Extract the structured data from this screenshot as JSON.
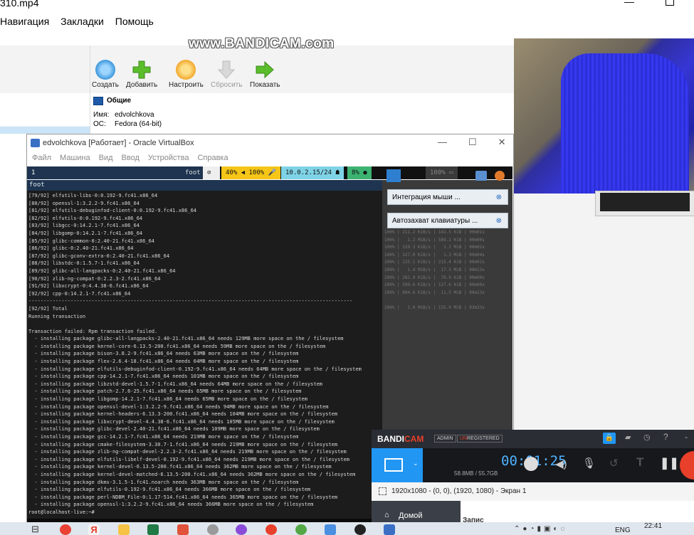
{
  "player": {
    "title": "310.mp4",
    "menu": [
      "Навигация",
      "Закладки",
      "Помощь"
    ]
  },
  "watermark": "www.BANDICAM.com",
  "vbox_manager": {
    "toolbar": [
      {
        "label": "Создать",
        "icon": "create-gear-icon"
      },
      {
        "label": "Добавить",
        "icon": "add-plus-icon"
      },
      {
        "label": "Настроить",
        "icon": "settings-gear-icon"
      },
      {
        "label": "Сбросить",
        "icon": "discard-arrow-icon"
      },
      {
        "label": "Показать",
        "icon": "show-arrow-icon"
      }
    ],
    "section": "Общие",
    "name_label": "Имя:",
    "name_value": "edvolchkova",
    "os_label": "ОС:",
    "os_value": "Fedora (64-bit)"
  },
  "vm": {
    "title": "edvolchkova [Работает] - Oracle VirtualBox",
    "menu": [
      "Файл",
      "Машина",
      "Вид",
      "Ввод",
      "Устройства",
      "Справка"
    ],
    "bar": {
      "workspace": "1",
      "app": "foot",
      "volume": "40% ◀ 100% 🎤",
      "ip": "10.0.2.15/24 ☗",
      "cpu": "8% ●",
      "extra": "100% ▭"
    },
    "terminal_title": "foot",
    "terminal_lines": [
      "[79/92] elfutils-libs-0:0.192-9.fc41.x86_64",
      "[80/92] openssl-1:3.2.2-9.fc41.x86_64",
      "[81/92] elfutils-debuginfod-client-0:0.192-9.fc41.x86_64",
      "[82/92] elfutils-0:0.192-9.fc41.x86_64",
      "[83/92] libgcc-0:14.2.1-7.fc41.x86_64",
      "[84/92] libgomp-0:14.2.1-7.fc41.x86_64",
      "[85/92] glibc-common-0:2.40-21.fc41.x86_64",
      "[86/92] glibc-0:2.40-21.fc41.x86_64",
      "[87/92] glibc-gconv-extra-0:2.40-21.fc41.x86_64",
      "[88/92] libstdc-0:1.5.7-1.fc41.x86_64",
      "[89/92] glibc-all-langpacks-0:2.40-21.fc41.x86_64",
      "[90/92] zlib-ng-compat-0:2.2.3-2.fc41.x86_64",
      "[91/92] libxcrypt-0:4.4.38-6.fc41.x86_64",
      "[92/92] cpp-0:14.2.1-7.fc41.x86_64",
      "------------------------------------------------------------------------------------------------------------",
      "[92/92] Total",
      "Running transaction",
      "",
      "Transaction failed: Rpm transaction failed.",
      "  - installing package glibc-all-langpacks-2.40-21.fc41.x86_64 needs 129MB more space on the / filesystem",
      "  - installing package kernel-core-6.13.5-200.fc41.x86_64 needs 59MB more space on the / filesystem",
      "  - installing package bison-3.8.2-9.fc41.x86_64 needs 63MB more space on the / filesystem",
      "  - installing package flex-2.6.4-18.fc41.x86_64 needs 64MB more space on the / filesystem",
      "  - installing package elfutils-debuginfod-client-0.192-9.fc41.x86_64 needs 64MB more space on the / filesystem",
      "  - installing package cpp-14.2.1-7.fc41.x86_64 needs 101MB more space on the / filesystem",
      "  - installing package libzstd-devel-1.5.7-1.fc41.x86_64 needs 64MB more space on the / filesystem",
      "  - installing package patch-2.7.6-25.fc41.x86_64 needs 65MB more space on the / filesystem",
      "  - installing package libgomp-14.2.1-7.fc41.x86_64 needs 65MB more space on the / filesystem",
      "  - installing package openssl-devel-1:3.2.2-9.fc41.x86_64 needs 94MB more space on the / filesystem",
      "  - installing package kernel-headers-6.13.3-200.fc41.x86_64 needs 104MB more space on the / filesystem",
      "  - installing package libxcrypt-devel-4.4.38-6.fc41.x86_64 needs 105MB more space on the / filesystem",
      "  - installing package glibc-devel-2.40-21.fc41.x86_64 needs 109MB more space on the / filesystem",
      "  - installing package gcc-14.2.1-7.fc41.x86_64 needs 219MB more space on the / filesystem",
      "  - installing package cmake-filesystem-3.30.7-1.fc41.x86_64 needs 219MB more space on the / filesystem",
      "  - installing package zlib-ng-compat-devel-2.2.3-2.fc41.x86_64 needs 219MB more space on the / filesystem",
      "  - installing package elfutils-libelf-devel-0.192-9.fc41.x86_64 needs 219MB more space on the / filesystem",
      "  - installing package kernel-devel-6.13.5-200.fc41.x86_64 needs 362MB more space on the / filesystem",
      "  - installing package kernel-devel-matched-6.13.5-200.fc41.x86_64 needs 362MB more space on the / filesystem",
      "  - installing package dkms-3.1.5-1.fc41.noarch needs 363MB more space on the / filesystem",
      "  - installing package elfutils-0.192-9.fc41.x86_64 needs 366MB more space on the / filesystem",
      "  - installing package perl-NDBM_File-0:1.17-514.fc41.x86_64 needs 365MB more space on the / filesystem",
      "  - installing package openssl-1:3.2.2-9.fc41.x86_64 needs 366MB more space on the / filesystem",
      "root@localhost-live:~# "
    ],
    "side_lines": [
      "100% | 211.2 KiB/s | 141.5 KiB | 00m01s",
      "100% |   1.2 MiB/s | 589.2 KiB | 00m00s",
      "100% | 320.3 KiB/s |   1.2 MiB | 00m02s",
      "100% | 327.0 KiB/s |   1.3 MiB | 00m04s",
      "100% | 125.1 KiB/s | 215.4 KiB | 00m02s",
      "100% |   1.4 MiB/s |  17.5 MiB | 00m13s",
      "100% | 281.9 KiB/s |  70.9 KiB | 00m00s",
      "100% | 390.6 KiB/s | 127.6 KiB | 00m00s",
      "100% | 894.6 KiB/s |  11.5 MiB | 00m13s",
      "",
      "100% |   1.0 MiB/s | 155.0 MiB | 03m33s"
    ],
    "notifications": [
      {
        "text": "Интеграция мыши ...",
        "icon": "mouse-integration-icon"
      },
      {
        "text": "Автозахват клавиатуры ...",
        "icon": "keyboard-capture-icon"
      }
    ]
  },
  "bandicam": {
    "brand_a": "BANDI",
    "brand_b": "CAM",
    "badge_admin": "ADMIN",
    "badge_unreg_a": "UN",
    "badge_unreg_b": "REGISTERED",
    "timer": "00:01:25",
    "size": "58.8MB / 55.7GB",
    "region": "1920x1080 - (0, 0), (1920, 1080) - Экран 1",
    "home": "Домой",
    "rec_label": "Запис"
  },
  "taskbar": {
    "lang": "ENG",
    "time": "22:41"
  },
  "colors": {
    "bandicam_accent": "#2196f3",
    "bandicam_red": "#e8402a",
    "waybar_yellow": "#f5c518",
    "waybar_green": "#3cb371",
    "waybar_cyan": "#7fd3e6"
  }
}
